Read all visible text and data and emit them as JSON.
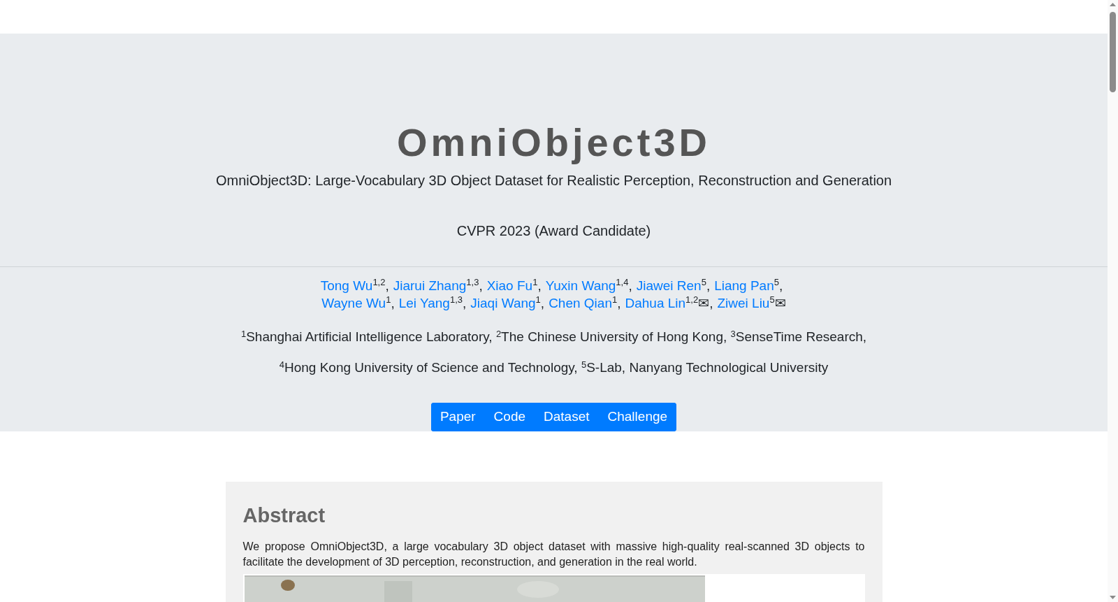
{
  "header": {
    "title": "OmniObject3D",
    "subtitle": "OmniObject3D: Large-Vocabulary 3D Object Dataset for Realistic Perception, Reconstruction and Generation",
    "venue": "CVPR 2023 (Award Candidate)"
  },
  "author_lines": [
    [
      {
        "name": "Tong Wu",
        "affil": "1,2",
        "separator": ","
      },
      {
        "name": "Jiarui Zhang",
        "affil": "1,3",
        "separator": ","
      },
      {
        "name": "Xiao Fu",
        "affil": "1",
        "separator": ","
      },
      {
        "name": "Yuxin Wang",
        "affil": "1,4",
        "separator": ","
      },
      {
        "name": "Jiawei Ren",
        "affil": "5",
        "separator": ","
      },
      {
        "name": "Liang Pan",
        "affil": "5",
        "separator": ","
      }
    ],
    [
      {
        "name": "Wayne Wu",
        "affil": "1",
        "separator": ","
      },
      {
        "name": "Lei Yang",
        "affil": "1,3",
        "separator": ","
      },
      {
        "name": "Jiaqi Wang",
        "affil": "1",
        "separator": ","
      },
      {
        "name": "Chen Qian",
        "affil": "1",
        "separator": ","
      },
      {
        "name": "Dahua Lin",
        "affil": "1,2",
        "mark": "✉",
        "separator": ","
      },
      {
        "name": "Ziwei Liu",
        "affil": "5",
        "mark": "✉"
      }
    ]
  ],
  "affiliations": [
    "$^{1}$Shanghai Artificial Intelligence Laboratory, $^{2}$The Chinese University of Hong Kong, $^{3}$SenseTime Research,",
    "$^{4}$Hong Kong University of Science and Technology, $^{5}$S-Lab, Nanyang Technological University"
  ],
  "buttons": [
    "Paper",
    "Code",
    "Dataset",
    "Challenge"
  ],
  "abstract": {
    "heading": "Abstract",
    "text": "We propose OmniObject3D, a large vocabulary 3D object dataset with massive high-quality real-scanned 3D objects to facilitate the development of 3D perception, reconstruction, and generation in the real world."
  }
}
